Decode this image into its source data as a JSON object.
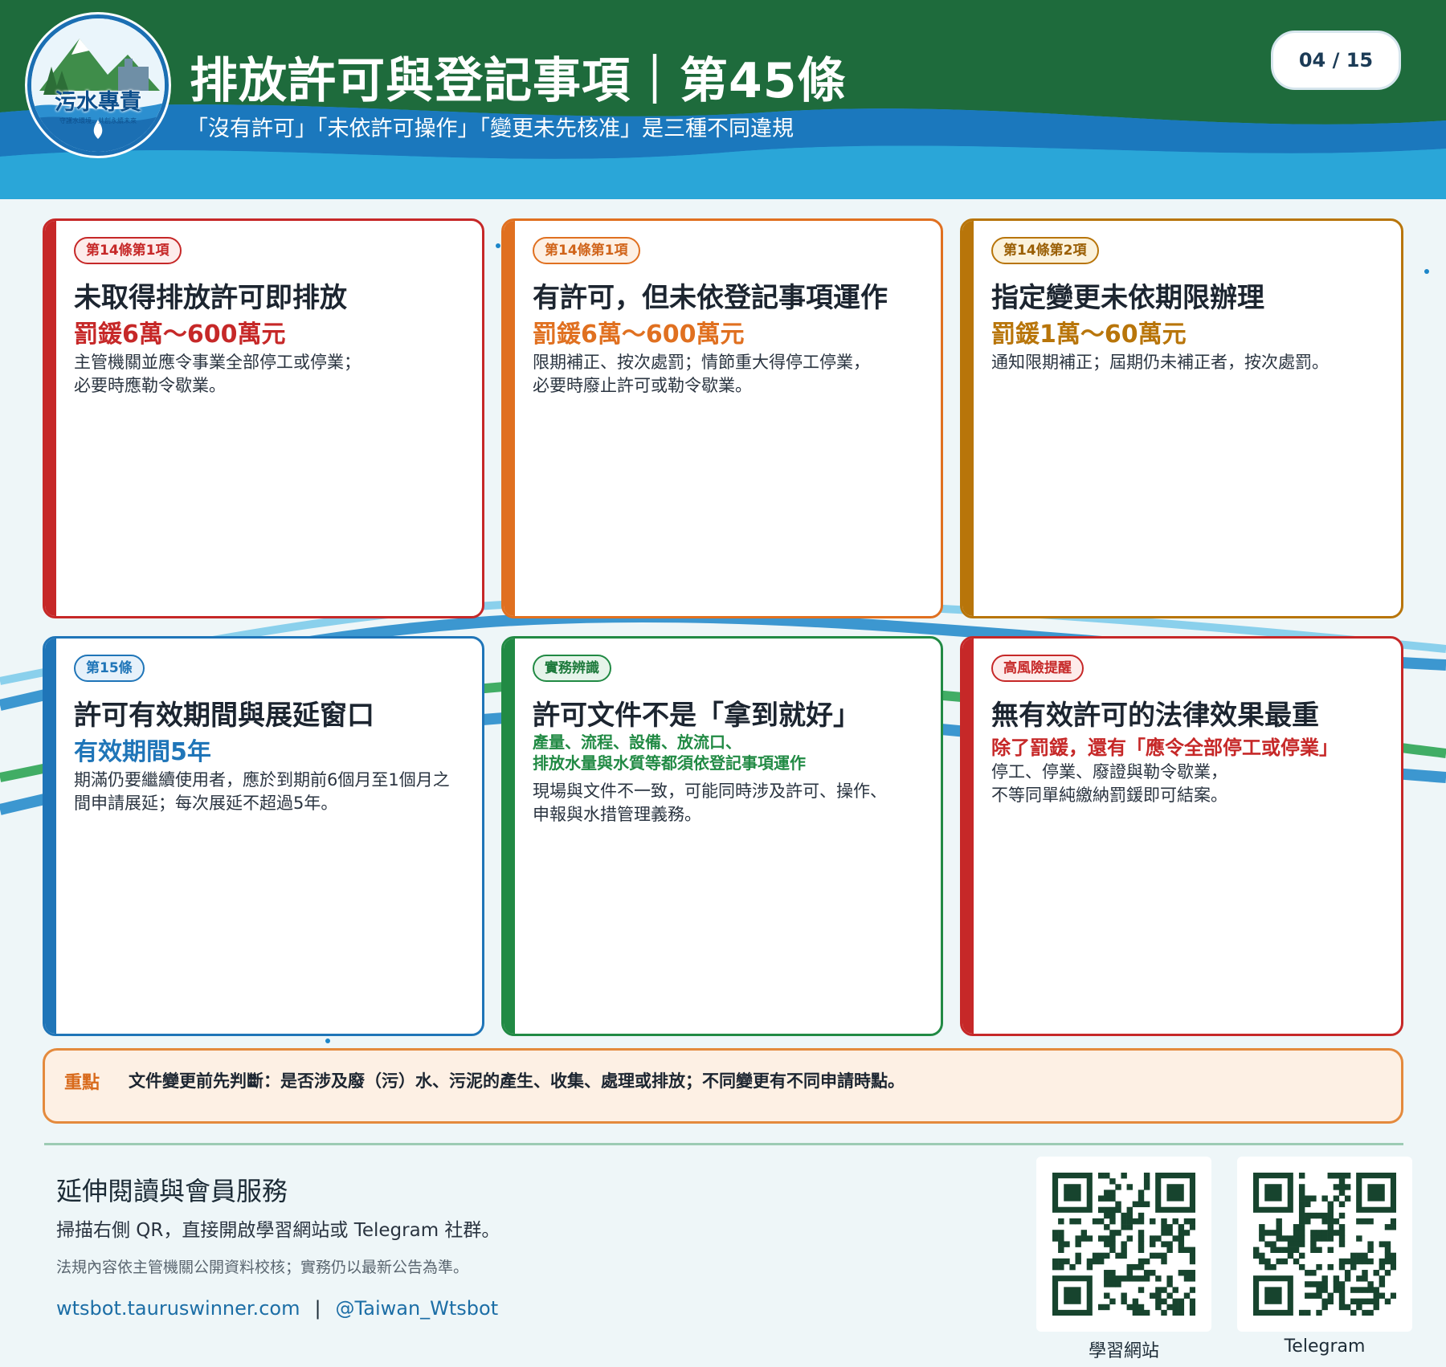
{
  "header": {
    "logo_text": "污水專責",
    "logo_sub": "守護水環境．共創永續未來",
    "title": "排放許可與登記事項｜第45條",
    "subtitle": "「沒有許可」「未依許可操作」「變更未先核准」是三種不同違規",
    "page_counter": "04 / 15"
  },
  "cards": [
    {
      "tag": "第14條第1項",
      "title": "未取得排放許可即排放",
      "highlight": "罰鍰6萬～600萬元",
      "body_lines": [
        "主管機關並應令事業全部停工或停業；",
        "必要時應勒令歇業。"
      ],
      "accent": "#c62828"
    },
    {
      "tag": "第14條第1項",
      "title": "有許可，但未依登記事項運作",
      "highlight": "罰鍰6萬～600萬元",
      "body_lines": [
        "限期補正、按次處罰；情節重大得停工停業，",
        "必要時廢止許可或勒令歇業。"
      ],
      "accent": "#e07020"
    },
    {
      "tag": "第14條第2項",
      "title": "指定變更未依期限辦理",
      "highlight": "罰鍰1萬～60萬元",
      "body_lines": [
        "通知限期補正；屆期仍未補正者，按次處罰。"
      ],
      "accent": "#b8750a"
    },
    {
      "tag": "第15條",
      "title": "許可有效期間與展延窗口",
      "highlight": "有效期間5年",
      "body_lines": [
        "期滿仍要繼續使用者，應於到期前6個月至1個月之",
        "間申請展延；每次展延不超過5年。"
      ],
      "accent": "#1f75b8"
    },
    {
      "tag": "實務辨識",
      "title": "許可文件不是「拿到就好」",
      "highlight_lines": [
        "產量、流程、設備、放流口、",
        "排放水量與水質等都須依登記事項運作"
      ],
      "body_lines": [
        "現場與文件不一致，可能同時涉及許可、操作、",
        "申報與水措管理義務。"
      ],
      "accent": "#218a44"
    },
    {
      "tag": "高風險提醒",
      "title": "無有效許可的法律效果最重",
      "highlight": "除了罰鍰，還有「應令全部停工或停業」",
      "body_lines": [
        "停工、停業、廢證與勒令歇業，",
        "不等同單純繳納罰鍰即可結案。"
      ],
      "accent": "#c62828"
    }
  ],
  "note": {
    "label": "重點",
    "text": "文件變更前先判斷：是否涉及廢（污）水、污泥的產生、收集、處理或排放；不同變更有不同申請時點。"
  },
  "footer": {
    "title": "延伸閱讀與會員服務",
    "desc": "掃描右側 QR，直接開啟學習網站或 Telegram 社群。",
    "note": "法規內容依主管機關公開資料校核；實務仍以最新公告為準。",
    "link_site": "wtsbot.tauruswinner.com",
    "link_sep": "|",
    "link_telegram": "@Taiwan_Wtsbot",
    "qr_site_label": "學習網站",
    "qr_telegram_label": "Telegram"
  },
  "colors": {
    "header_green": "#1e6b3c",
    "header_blue": "#2a9fd6",
    "note_border": "#e48a3d",
    "note_bg": "#fdf0e4"
  }
}
